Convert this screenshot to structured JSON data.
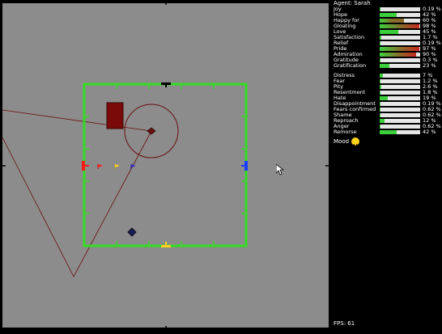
{
  "agent": {
    "title": "Agent: Sarah"
  },
  "emotions_group1": [
    {
      "name": "Joy",
      "value": "0.19 %",
      "level": 0.02,
      "color": "#3ccf3c"
    },
    {
      "name": "Hope",
      "value": "42 %",
      "level": 0.42,
      "color": "#3ccf3c"
    },
    {
      "name": "Happy for",
      "value": "60 %",
      "level": 0.6,
      "color": "#8a6a2a"
    },
    {
      "name": "Gloating",
      "value": "98 %",
      "level": 0.98,
      "color": "#c8281e"
    },
    {
      "name": "Love",
      "value": "45 %",
      "level": 0.45,
      "color": "#3ccf3c"
    },
    {
      "name": "Satisfaction",
      "value": "1.7 %",
      "level": 0.03,
      "color": "#3ccf3c"
    },
    {
      "name": "Relief",
      "value": "0.19 %",
      "level": 0.02,
      "color": "#3ccf3c"
    },
    {
      "name": "Pride",
      "value": "97 %",
      "level": 0.97,
      "color": "#c8281e"
    },
    {
      "name": "Admiration",
      "value": "90 %",
      "level": 0.9,
      "color": "#c8281e"
    },
    {
      "name": "Gratitude",
      "value": "0.3 %",
      "level": 0.02,
      "color": "#3ccf3c"
    },
    {
      "name": "Gratification",
      "value": "23 %",
      "level": 0.23,
      "color": "#3ccf3c"
    }
  ],
  "emotions_group2": [
    {
      "name": "Distress",
      "value": "7 %",
      "level": 0.07,
      "color": "#3ccf3c"
    },
    {
      "name": "Fear",
      "value": "1.2 %",
      "level": 0.02,
      "color": "#3ccf3c"
    },
    {
      "name": "Pity",
      "value": "2.6 %",
      "level": 0.03,
      "color": "#3ccf3c"
    },
    {
      "name": "Resentment",
      "value": "1.8 %",
      "level": 0.02,
      "color": "#3ccf3c"
    },
    {
      "name": "Hate",
      "value": "19 %",
      "level": 0.19,
      "color": "#3ccf3c"
    },
    {
      "name": "Disappointment",
      "value": "0.19 %",
      "level": 0.02,
      "color": "#3ccf3c"
    },
    {
      "name": "Fears confirmed",
      "value": "0.62 %",
      "level": 0.02,
      "color": "#3ccf3c"
    },
    {
      "name": "Shame",
      "value": "0.62 %",
      "level": 0.02,
      "color": "#3ccf3c"
    },
    {
      "name": "Reproach",
      "value": "12 %",
      "level": 0.12,
      "color": "#3ccf3c"
    },
    {
      "name": "Anger",
      "value": "0.62 %",
      "level": 0.02,
      "color": "#3ccf3c"
    },
    {
      "name": "Remorse",
      "value": "42 %",
      "level": 0.42,
      "color": "#3ccf3c"
    }
  ],
  "mood": {
    "label": "Mood",
    "icon": "smiley-icon"
  },
  "fps": {
    "label": "FPS: 61"
  },
  "colors": {
    "arena_bg": "#8c8c8c",
    "field_border": "#33dd22",
    "trail": "#6b0f0f",
    "obstacle": "#7a0a0a",
    "team_red": "#ff1a1a",
    "team_blue": "#1a3cff",
    "team_yellow": "#ffd21a"
  }
}
